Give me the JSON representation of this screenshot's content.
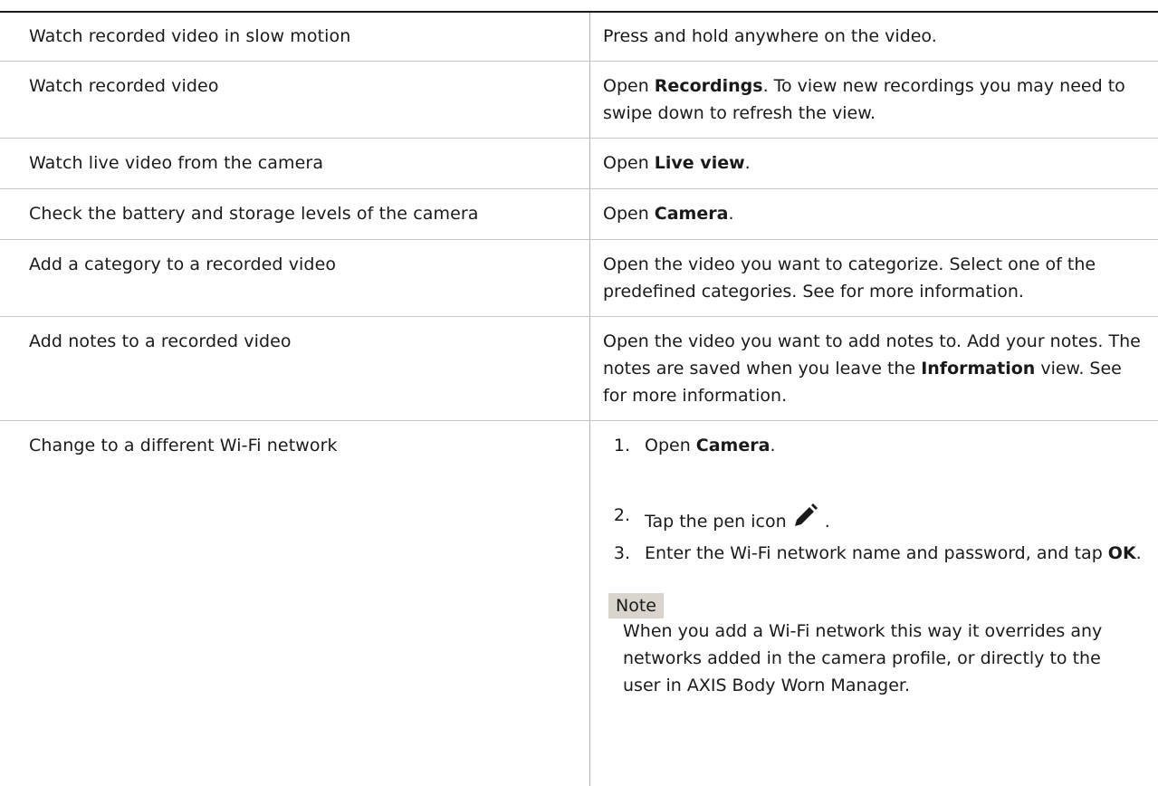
{
  "rows": [
    {
      "task": "Watch recorded video in slow motion",
      "action": "Press and hold anywhere on the video."
    },
    {
      "task": "Watch recorded video",
      "action_pre": "Open ",
      "action_bold": "Recordings",
      "action_post": ". To view new recordings you may need to swipe down to refresh the view."
    },
    {
      "task": "Watch live video from the camera",
      "action_pre": "Open ",
      "action_bold": "Live view",
      "action_post": "."
    },
    {
      "task": "Check the battery and storage levels of the camera",
      "action_pre": "Open ",
      "action_bold": "Camera",
      "action_post": "."
    },
    {
      "task": "Add a category to a recorded video",
      "action": "Open the video you want to categorize. Select one of the predefined categories. See for more information."
    },
    {
      "task": "Add notes to a recorded video",
      "action_pre": "Open the video you want to add notes to. Add your notes. The notes are saved when you leave the ",
      "action_bold": "Information",
      "action_post": " view. See for more information."
    },
    {
      "task": "Change to a different Wi-Fi network"
    }
  ],
  "wifi_steps": [
    {
      "num": "1.",
      "pre": "Open ",
      "bold": "Camera",
      "post": "."
    },
    {
      "num": "2.",
      "pre": "Tap the pen icon",
      "bold": "",
      "post": "."
    },
    {
      "num": "3.",
      "pre": "Enter the Wi-Fi network name and password, and tap ",
      "bold": "OK",
      "post": "."
    }
  ],
  "note": {
    "label": "Note",
    "text": "When you add a Wi-Fi network this way it overrides any networks added in the camera profile, or directly to the user in AXIS Body Worn Manager."
  },
  "icons": {
    "pen": "pen-icon"
  }
}
